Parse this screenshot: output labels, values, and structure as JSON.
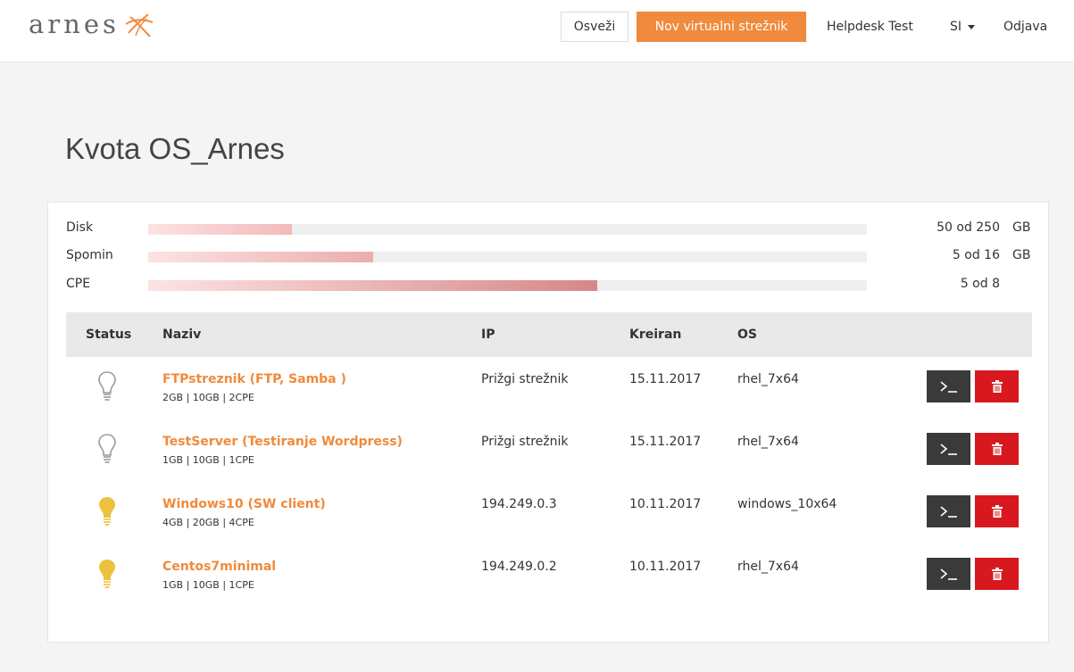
{
  "brand": {
    "name": "arnes",
    "accent": "#f08a3c"
  },
  "nav": {
    "refresh_label": "Osveži",
    "new_server_label": "Nov virtualni strežnik",
    "user_label": "Helpdesk Test",
    "lang_label": "SI",
    "logout_label": "Odjava"
  },
  "page": {
    "title": "Kvota OS_Arnes"
  },
  "quota": [
    {
      "label": "Disk",
      "value": "50 od 250",
      "unit": "GB",
      "fraction": 0.2
    },
    {
      "label": "Spomin",
      "value": "5 od 16",
      "unit": "GB",
      "fraction": 0.3125
    },
    {
      "label": "CPE",
      "value": "5 od 8",
      "unit": "",
      "fraction": 0.625
    }
  ],
  "table": {
    "headers": {
      "status": "Status",
      "name": "Naziv",
      "ip": "IP",
      "created": "Kreiran",
      "os": "OS"
    },
    "rows": [
      {
        "status": "off",
        "name": "FTPstreznik (FTP, Samba )",
        "spec": "2GB | 10GB | 2CPE",
        "ip": "Prižgi strežnik",
        "created": "15.11.2017",
        "os": "rhel_7x64"
      },
      {
        "status": "off",
        "name": "TestServer (Testiranje Wordpress)",
        "spec": "1GB | 10GB | 1CPE",
        "ip": "Prižgi strežnik",
        "created": "15.11.2017",
        "os": "rhel_7x64"
      },
      {
        "status": "on",
        "name": "Windows10 (SW client)",
        "spec": "4GB | 20GB | 4CPE",
        "ip": "194.249.0.3",
        "created": "10.11.2017",
        "os": "windows_10x64"
      },
      {
        "status": "on",
        "name": "Centos7minimal",
        "spec": "1GB | 10GB | 1CPE",
        "ip": "194.249.0.2",
        "created": "10.11.2017",
        "os": "rhel_7x64"
      }
    ]
  },
  "colors": {
    "bulb_on": "#ecc23c",
    "bulb_off": "#9a9a9a",
    "delete": "#d7191f",
    "console": "#3a3a3a"
  },
  "icons": {
    "status_on": "lightbulb-on-icon",
    "status_off": "lightbulb-off-icon",
    "console": "terminal-icon",
    "delete": "trash-icon"
  }
}
